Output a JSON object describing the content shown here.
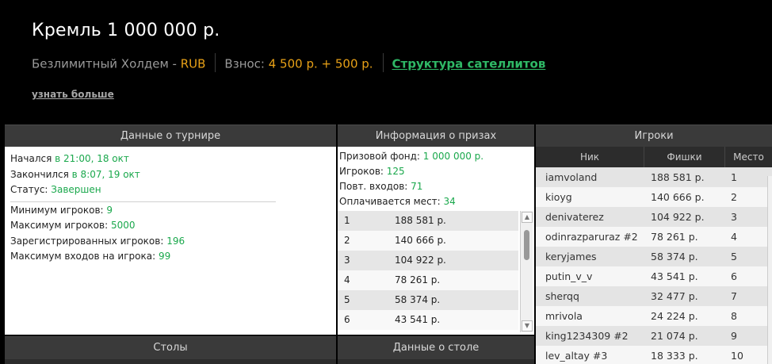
{
  "header": {
    "title": "Кремль 1 000 000 р.",
    "game_type": "Безлимитный Холдем - ",
    "currency": "RUB",
    "buyin_label": "Взнос: ",
    "buyin_value": "4 500 р. + 500 р.",
    "satellite_link": "Структура сателлитов",
    "learn_more": "узнать больше"
  },
  "colors": {
    "accent_green": "#1aa84c",
    "accent_orange": "#e8a117",
    "link_green": "#2fb866"
  },
  "tournament": {
    "title": "Данные о турнире",
    "started_label": "Начался ",
    "started_value": "в 21:00, 18 окт",
    "ended_label": "Закончился ",
    "ended_value": "в 8:07, 19 окт",
    "status_label": "Статус: ",
    "status_value": "Завершен",
    "min_label": "Минимум игроков: ",
    "min_value": "9",
    "max_label": "Максимум игроков: ",
    "max_value": "5000",
    "registered_label": "Зарегистрированных игроков: ",
    "registered_value": "196",
    "max_entries_label": "Максимум входов на игрока: ",
    "max_entries_value": "99"
  },
  "prizes": {
    "title": "Информация о призах",
    "pool_label": "Призовой фонд: ",
    "pool_value": "1 000 000 р.",
    "players_label": "Игроков: ",
    "players_value": "125",
    "reentries_label": "Повт. входов: ",
    "reentries_value": "71",
    "paid_label": "Оплачивается мест: ",
    "paid_value": "34",
    "rows": [
      {
        "place": "1",
        "amount": "188 581 р."
      },
      {
        "place": "2",
        "amount": "140 666 р."
      },
      {
        "place": "3",
        "amount": "104 922 р."
      },
      {
        "place": "4",
        "amount": "78 261 р."
      },
      {
        "place": "5",
        "amount": "58 374 р."
      },
      {
        "place": "6",
        "amount": "43 541 р."
      }
    ]
  },
  "players": {
    "title": "Игроки",
    "col_nick": "Ник",
    "col_chips": "Фишки",
    "col_place": "Место",
    "rows": [
      {
        "nick": "iamvoland",
        "chips": "188 581 р.",
        "place": "1"
      },
      {
        "nick": "kioyg",
        "chips": "140 666 р.",
        "place": "2"
      },
      {
        "nick": "denivaterez",
        "chips": "104 922 р.",
        "place": "3"
      },
      {
        "nick": "odinrazparuraz #2",
        "chips": "78 261 р.",
        "place": "4"
      },
      {
        "nick": "keryjames",
        "chips": "58 374 р.",
        "place": "5"
      },
      {
        "nick": "putin_v_v",
        "chips": "43 541 р.",
        "place": "6"
      },
      {
        "nick": "sherqq",
        "chips": "32 477 р.",
        "place": "7"
      },
      {
        "nick": "mrivola",
        "chips": "24 224 р.",
        "place": "8"
      },
      {
        "nick": "king1234309 #2",
        "chips": "21 074 р.",
        "place": "9"
      },
      {
        "nick": "lev_altay #3",
        "chips": "18 333 р.",
        "place": "10"
      }
    ]
  },
  "tables": {
    "title": "Столы"
  },
  "table_data": {
    "title": "Данные о столе"
  }
}
